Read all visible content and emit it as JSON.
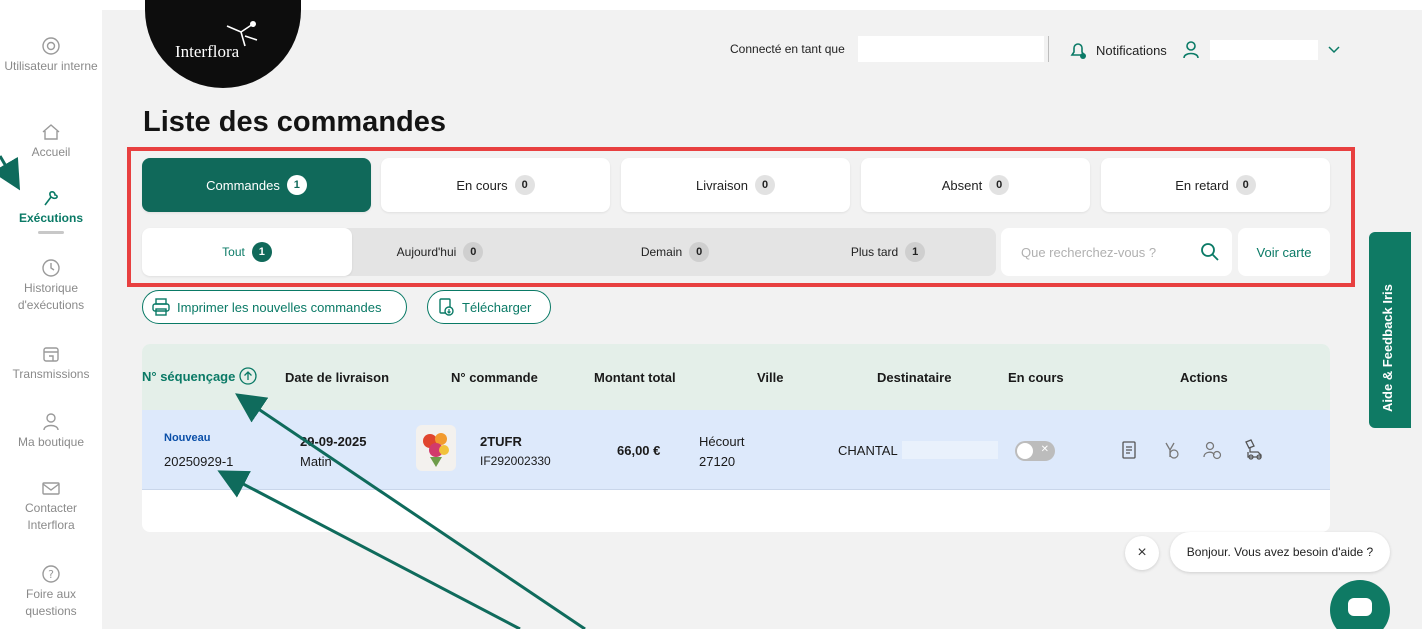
{
  "sidebar": {
    "items": [
      {
        "label": "Utilisateur interne",
        "icon": "gear-icon"
      },
      {
        "label": "Accueil",
        "icon": "home-icon"
      },
      {
        "label": "Exécutions",
        "icon": "flower-icon",
        "active": true
      },
      {
        "label": "Historique d'exécutions",
        "icon": "clock-icon"
      },
      {
        "label": "Transmissions",
        "icon": "store-icon"
      },
      {
        "label": "Ma boutique",
        "icon": "user-icon"
      },
      {
        "label": "Contacter Interflora",
        "icon": "mail-icon"
      },
      {
        "label": "Foire aux questions",
        "icon": "question-icon"
      }
    ]
  },
  "header": {
    "logo": "Interflora",
    "connected_label": "Connecté en tant que",
    "notifications_label": "Notifications"
  },
  "page": {
    "title": "Liste des commandes"
  },
  "tabs": [
    {
      "label": "Commandes",
      "count": "1",
      "active": true
    },
    {
      "label": "En cours",
      "count": "0"
    },
    {
      "label": "Livraison",
      "count": "0"
    },
    {
      "label": "Absent",
      "count": "0"
    },
    {
      "label": "En retard",
      "count": "0"
    }
  ],
  "subtabs": [
    {
      "label": "Tout",
      "count": "1",
      "active": true
    },
    {
      "label": "Aujourd'hui",
      "count": "0"
    },
    {
      "label": "Demain",
      "count": "0"
    },
    {
      "label": "Plus tard",
      "count": "1"
    }
  ],
  "search": {
    "placeholder": "Que recherchez-vous ?"
  },
  "map_button": "Voir carte",
  "actions": {
    "print_label": "Imprimer les nouvelles commandes",
    "download_label": "Télécharger"
  },
  "table": {
    "headers": [
      "N° séquençage",
      "Date de livraison",
      "N° commande",
      "Montant total",
      "Ville",
      "Destinataire",
      "En cours",
      "Actions"
    ],
    "rows": [
      {
        "status": "Nouveau",
        "sequence": "20250929-1",
        "date": "29-09-2025",
        "slot": "Matin",
        "order_code": "2TUFR",
        "order_id": "IF292002330",
        "amount": "66,00 €",
        "city": "Hécourt",
        "postcode": "27120",
        "recipient": "CHANTAL",
        "in_progress": false
      }
    ]
  },
  "feedback": {
    "label": "Aide & Feedback Iris"
  },
  "chat": {
    "message": "Bonjour. Vous avez besoin d'aide ?",
    "close": "×"
  },
  "colors": {
    "accent": "#10695a",
    "highlight_border": "#e84040",
    "row_bg": "#dde9fb"
  }
}
